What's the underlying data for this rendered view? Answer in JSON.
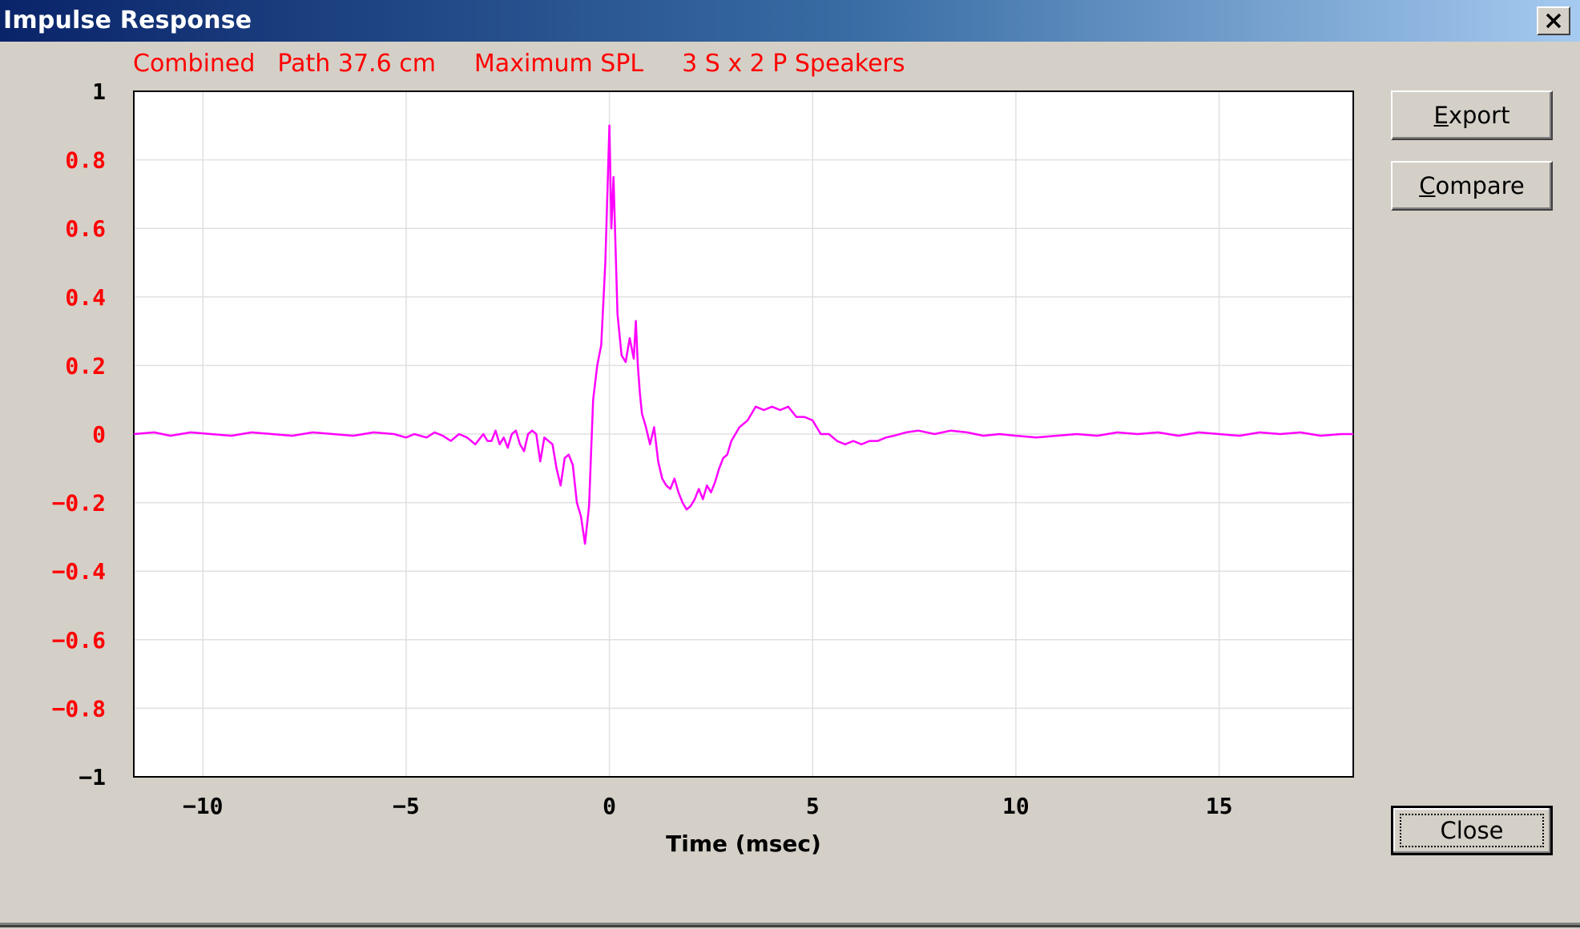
{
  "window": {
    "title": "Impulse Response",
    "close_icon": "close-x-icon"
  },
  "info_line": {
    "mode": "Combined",
    "path": "Path 37.6 cm",
    "level": "Maximum SPL",
    "speakers": "3 S x 2 P Speakers"
  },
  "buttons": {
    "export": {
      "accel": "E",
      "rest": "xport"
    },
    "compare": {
      "accel": "C",
      "rest": "ompare"
    },
    "close": "Close"
  },
  "colors": {
    "trace": "#ff00ff",
    "info_text": "#ff0000",
    "y_tick_labels": "#ff0000",
    "y_tick_labels_ends": "#000000",
    "grid": "#e0e0e0",
    "background": "#d4d0c8"
  },
  "chart_data": {
    "type": "line",
    "title": "",
    "xlabel": "Time (msec)",
    "ylabel": "",
    "xlim": [
      -11.7,
      18.3
    ],
    "ylim": [
      -1,
      1
    ],
    "x_ticks": [
      -10,
      -5,
      0,
      5,
      10,
      15
    ],
    "x_tick_labels": [
      "−10",
      "−5",
      "0",
      "5",
      "10",
      "15"
    ],
    "y_ticks": [
      1,
      0.8,
      0.6,
      0.4,
      0.2,
      0,
      -0.2,
      -0.4,
      -0.6,
      -0.8,
      -1
    ],
    "y_tick_labels": [
      "1",
      "0.8",
      "0.6",
      "0.4",
      "0.2",
      "0",
      "−0.2",
      "−0.4",
      "−0.6",
      "−0.8",
      "−1"
    ],
    "grid": true,
    "series": [
      {
        "x": [
          -11.7,
          -11.2,
          -10.8,
          -10.3,
          -9.8,
          -9.3,
          -8.8,
          -8.3,
          -7.8,
          -7.3,
          -6.8,
          -6.3,
          -5.8,
          -5.3,
          -5.0,
          -4.8,
          -4.5,
          -4.3,
          -4.1,
          -3.9,
          -3.7,
          -3.5,
          -3.3,
          -3.1,
          -3.0,
          -2.9,
          -2.8,
          -2.7,
          -2.6,
          -2.5,
          -2.4,
          -2.3,
          -2.2,
          -2.1,
          -2.0,
          -1.9,
          -1.8,
          -1.7,
          -1.6,
          -1.5,
          -1.4,
          -1.3,
          -1.2,
          -1.1,
          -1.0,
          -0.9,
          -0.8,
          -0.7,
          -0.6,
          -0.5,
          -0.45,
          -0.4,
          -0.3,
          -0.2,
          -0.1,
          0.0,
          0.05,
          0.1,
          0.15,
          0.2,
          0.3,
          0.4,
          0.5,
          0.6,
          0.65,
          0.7,
          0.75,
          0.8,
          0.9,
          1.0,
          1.1,
          1.2,
          1.3,
          1.4,
          1.5,
          1.6,
          1.7,
          1.8,
          1.9,
          2.0,
          2.1,
          2.2,
          2.3,
          2.4,
          2.5,
          2.6,
          2.7,
          2.8,
          2.9,
          3.0,
          3.2,
          3.4,
          3.6,
          3.8,
          4.0,
          4.2,
          4.4,
          4.6,
          4.8,
          5.0,
          5.2,
          5.4,
          5.6,
          5.8,
          6.0,
          6.2,
          6.4,
          6.6,
          6.8,
          7.0,
          7.3,
          7.6,
          8.0,
          8.4,
          8.8,
          9.2,
          9.6,
          10.0,
          10.5,
          11.0,
          11.5,
          12.0,
          12.5,
          13.0,
          13.5,
          14.0,
          14.5,
          15.0,
          15.5,
          16.0,
          16.5,
          17.0,
          17.5,
          18.0,
          18.3
        ],
        "y": [
          0.0,
          0.005,
          -0.005,
          0.005,
          0.0,
          -0.005,
          0.005,
          0.0,
          -0.005,
          0.005,
          0.0,
          -0.005,
          0.005,
          0.0,
          -0.01,
          0.0,
          -0.01,
          0.005,
          -0.005,
          -0.02,
          0.0,
          -0.01,
          -0.03,
          0.0,
          -0.02,
          -0.02,
          0.01,
          -0.03,
          -0.01,
          -0.04,
          0.0,
          0.01,
          -0.03,
          -0.05,
          0.0,
          0.01,
          0.0,
          -0.08,
          -0.01,
          -0.02,
          -0.03,
          -0.1,
          -0.15,
          -0.07,
          -0.06,
          -0.09,
          -0.2,
          -0.24,
          -0.32,
          -0.21,
          -0.05,
          0.1,
          0.2,
          0.26,
          0.5,
          0.9,
          0.6,
          0.75,
          0.55,
          0.35,
          0.23,
          0.21,
          0.28,
          0.22,
          0.33,
          0.2,
          0.12,
          0.06,
          0.02,
          -0.03,
          0.02,
          -0.08,
          -0.13,
          -0.15,
          -0.16,
          -0.13,
          -0.17,
          -0.2,
          -0.22,
          -0.21,
          -0.19,
          -0.16,
          -0.19,
          -0.15,
          -0.17,
          -0.14,
          -0.1,
          -0.07,
          -0.06,
          -0.02,
          0.02,
          0.04,
          0.08,
          0.07,
          0.08,
          0.07,
          0.08,
          0.05,
          0.05,
          0.04,
          0.0,
          0.0,
          -0.02,
          -0.03,
          -0.02,
          -0.03,
          -0.02,
          -0.02,
          -0.01,
          -0.005,
          0.005,
          0.01,
          0.0,
          0.01,
          0.005,
          -0.005,
          0.0,
          -0.005,
          -0.01,
          -0.005,
          0.0,
          -0.005,
          0.005,
          0.0,
          0.005,
          -0.005,
          0.005,
          0.0,
          -0.005,
          0.005,
          0.0,
          0.005,
          -0.005,
          0.0,
          0.0
        ]
      }
    ]
  }
}
